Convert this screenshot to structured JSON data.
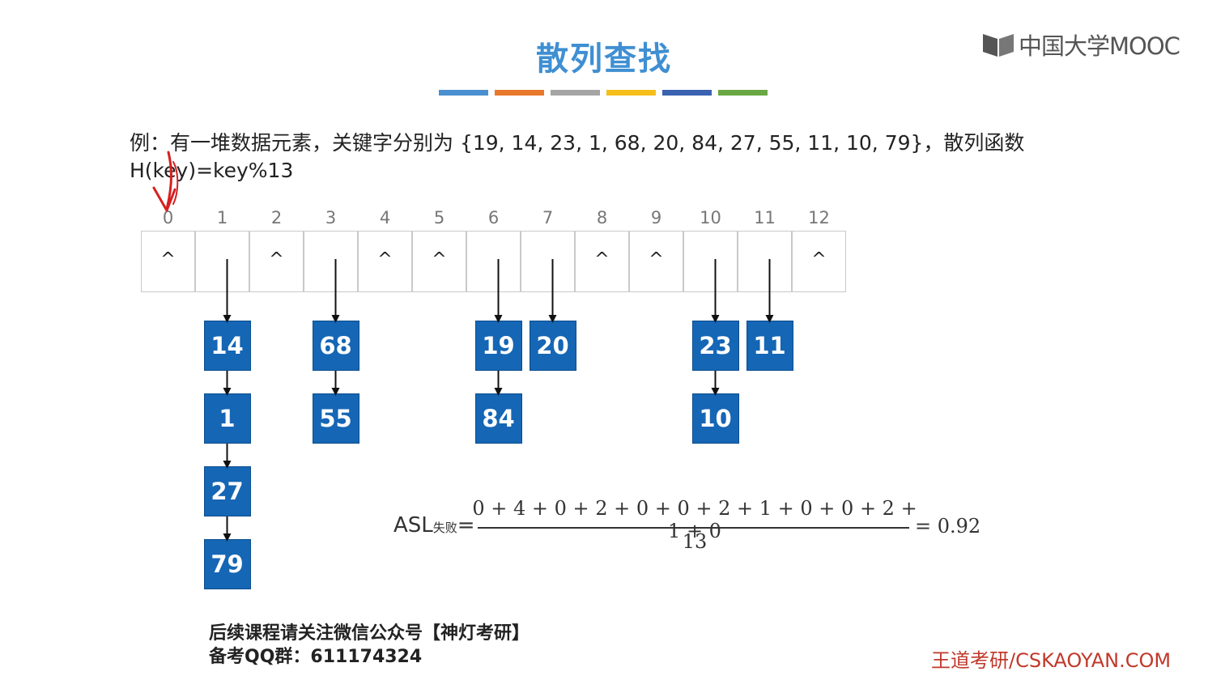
{
  "header": {
    "title": "散列查找",
    "logo_text": "中国大学MOOC",
    "color_bar": [
      "#4a8fcf",
      "#e8782a",
      "#a5a5a5",
      "#f5bf1b",
      "#3a62b0",
      "#69a844"
    ]
  },
  "problem": {
    "line1": "例：有一堆数据元素，关键字分别为 {19, 14, 23, 1, 68, 20, 84, 27, 55, 11, 10, 79}，散列函数",
    "line2": "H(key)=key%13"
  },
  "hash_table": {
    "indices": [
      "0",
      "1",
      "2",
      "3",
      "4",
      "5",
      "6",
      "7",
      "8",
      "9",
      "10",
      "11",
      "12"
    ],
    "empty_symbol": "^",
    "empty_slots": [
      0,
      2,
      4,
      5,
      8,
      9,
      12
    ],
    "chains": [
      {
        "slot": 1,
        "keys": [
          "14",
          "1",
          "27",
          "79"
        ]
      },
      {
        "slot": 3,
        "keys": [
          "68",
          "55"
        ]
      },
      {
        "slot": 6,
        "keys": [
          "19",
          "84"
        ]
      },
      {
        "slot": 7,
        "keys": [
          "20"
        ]
      },
      {
        "slot": 10,
        "keys": [
          "23",
          "10"
        ]
      },
      {
        "slot": 11,
        "keys": [
          "11"
        ]
      }
    ]
  },
  "asl": {
    "label": "ASL",
    "label_sub": "失败",
    "eq": "=",
    "numerator": "0 + 4 + 0 + 2 + 0 + 0 + 2 + 1 + 0 + 0 + 2 + 1 + 0",
    "denominator": "13",
    "result": "= 0.92"
  },
  "footer": {
    "line1": "后续课程请关注微信公众号【神灯考研】",
    "line2": "备考QQ群：611174324",
    "watermark": "王道考研/CSKAOYAN.COM"
  },
  "colors": {
    "node_fill": "#1566b5",
    "title": "#3f8fd2",
    "watermark": "#c0392b",
    "annotation": "#d62020"
  }
}
